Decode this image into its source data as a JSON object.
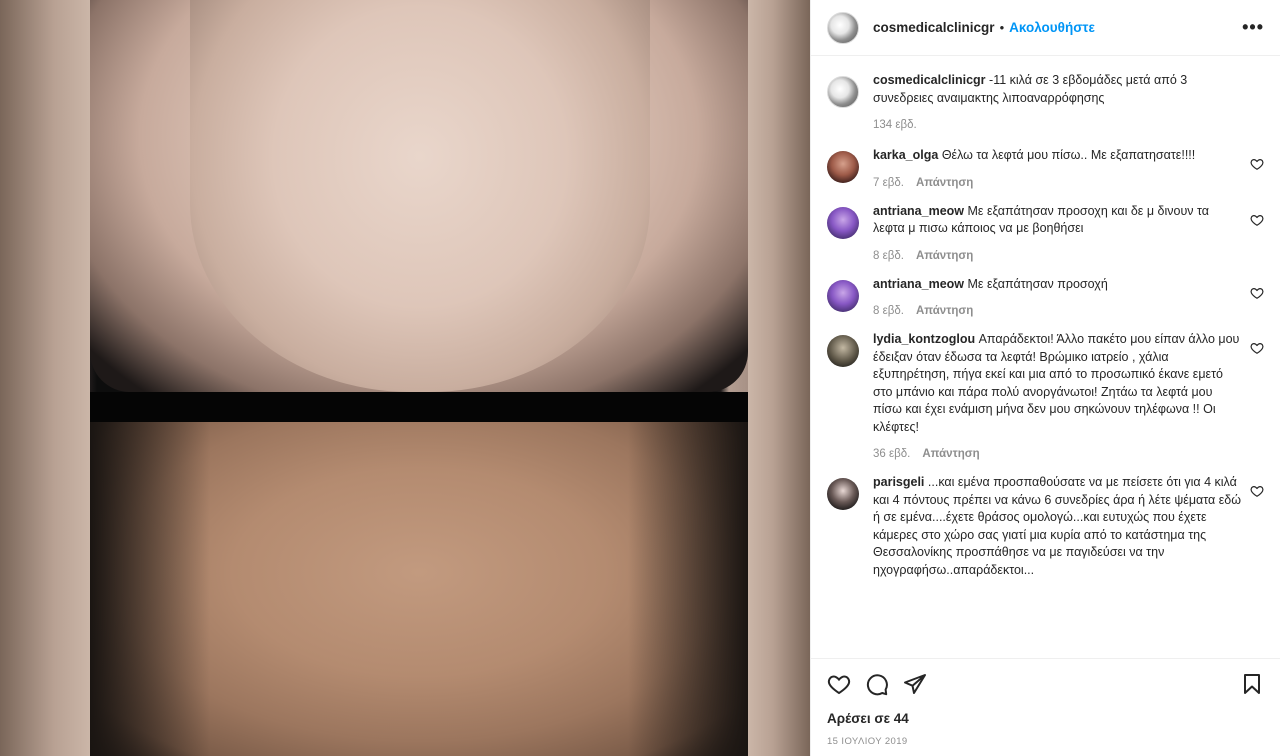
{
  "post": {
    "username": "cosmedicalclinicgr",
    "follow_label": "Ακολουθήστε",
    "more_label": "•••",
    "caption": {
      "username": "cosmedicalclinicgr",
      "text": "-11 κιλά σε 3 εβδομάδες μετά από 3 συνεδρειες αναιμακτης λιποαναρρόφησης",
      "time": "134 εβδ."
    },
    "likes": "Αρέσει σε 44",
    "date": "15 ΙΟΥΛΙΟΥ 2019",
    "reply_label": "Απάντηση"
  },
  "comments": [
    {
      "username": "karka_olga",
      "text": "Θέλω τα λεφτά μου πίσω.. Με εξαπατησατε!!!!",
      "time": "7 εβδ."
    },
    {
      "username": "antriana_meow",
      "text": "Με εξαπάτησαν προσοχη και δε μ δινουν τα λεφτα μ πισω κάποιος να με βοηθήσει",
      "time": "8 εβδ."
    },
    {
      "username": "antriana_meow",
      "text": "Με εξαπάτησαν προσοχή",
      "time": "8 εβδ."
    },
    {
      "username": "lydia_kontzoglou",
      "text": "Απαράδεκτοι! Άλλο πακέτο μου είπαν άλλο μου έδειξαν όταν έδωσα τα λεφτά! Βρώμικο ιατρείο , χάλια εξυπηρέτηση, πήγα εκεί και μια από το προσωπικό έκανε εμετό στο μπάνιο και πάρα πολύ ανοργάνωτοι! Ζητάω τα λεφτά μου πίσω και έχει ενάμιση μήνα δεν μου σηκώνουν τηλέφωνα !! Οι κλέφτες!",
      "time": "36 εβδ."
    },
    {
      "username": "parisgeli",
      "text": "...και εμένα προσπαθούσατε να με πείσετε ότι για 4 κιλά και 4 πόντους πρέπει να κάνω 6 συνεδρίες άρα ή λέτε ψέματα εδώ ή σε εμένα....έχετε θράσος ομολογώ...και ευτυχώς που έχετε κάμερες στο χώρο σας γιατί μια κυρία από το κατάστημα της Θεσσαλονίκης προσπάθησε να με παγιδεύσει να την ηχογραφήσω..απαράδεκτοι...",
      "time": ""
    }
  ],
  "icons": {
    "like": "heart-icon",
    "comment": "comment-icon",
    "share": "share-icon",
    "save": "bookmark-icon"
  },
  "colors": {
    "accent": "#0095f6",
    "muted": "#8e8e8e",
    "text": "#262626"
  }
}
